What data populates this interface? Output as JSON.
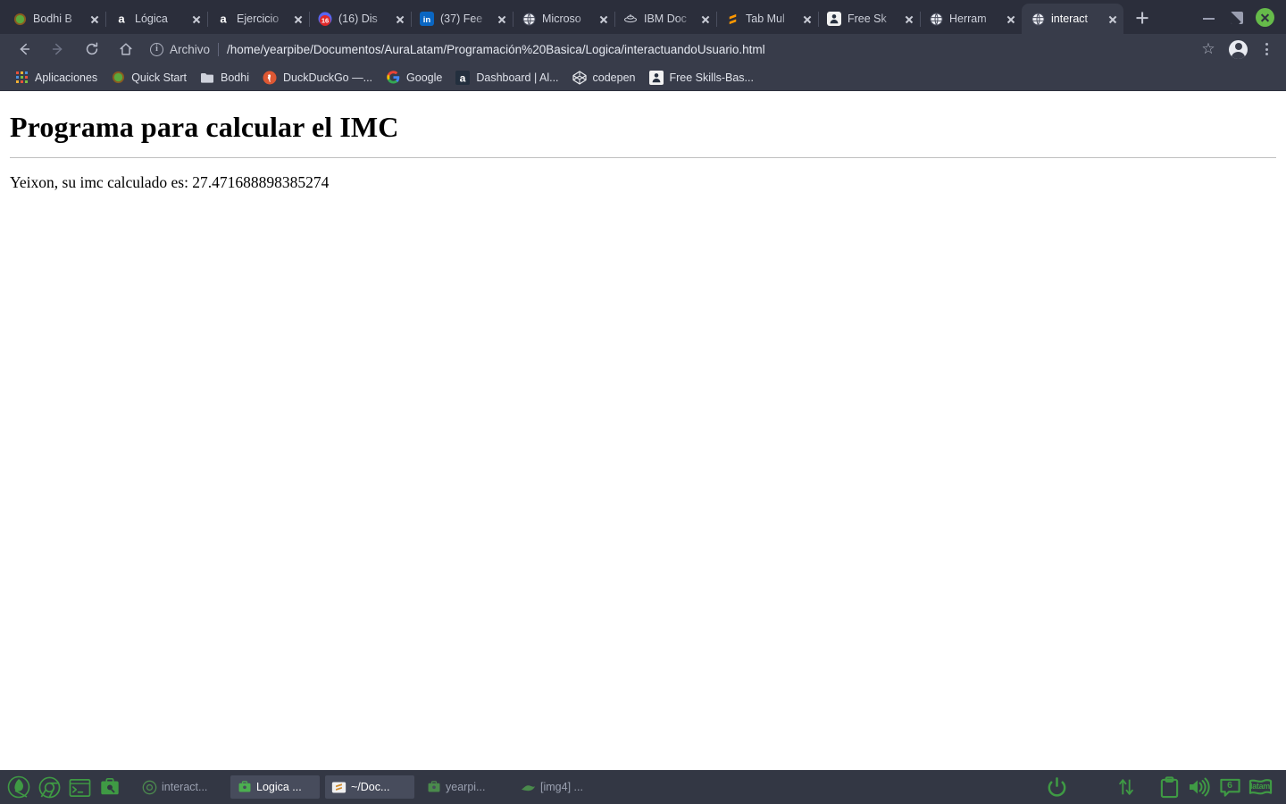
{
  "window": {
    "controls": {
      "minimize": "minimize",
      "maximize": "maximize",
      "close": "close"
    }
  },
  "tabs": [
    {
      "title": "Bodhi B",
      "favicon": "bodhi-leaf",
      "active": false
    },
    {
      "title": "Lógica ",
      "favicon": "amazon-a",
      "active": false
    },
    {
      "title": "Ejercicio",
      "favicon": "amazon-a",
      "active": false
    },
    {
      "title": "(16) Dis",
      "favicon": "discord-badge",
      "badge": "16",
      "active": false
    },
    {
      "title": "(37) Fee",
      "favicon": "linkedin-in",
      "active": false
    },
    {
      "title": "Microso",
      "favicon": "globe",
      "active": false
    },
    {
      "title": "IBM Doc",
      "favicon": "ibm-cloud",
      "active": false
    },
    {
      "title": "Tab Mul",
      "favicon": "sublime-s",
      "active": false
    },
    {
      "title": "Free Sk",
      "favicon": "freeskills",
      "active": false
    },
    {
      "title": "Herram",
      "favicon": "globe",
      "active": false
    },
    {
      "title": "interact",
      "favicon": "globe",
      "active": true
    }
  ],
  "newtab_label": "+",
  "toolbar": {
    "back": "Atrás",
    "forward": "Adelante",
    "reload": "Recargar",
    "home": "Inicio",
    "security_label": "Archivo",
    "url": "/home/yearpibe/Documentos/AuraLatam/Programación%20Basica/Logica/interactuandoUsuario.html",
    "bookmark_star": "☆",
    "profile": "profile",
    "menu": "menu"
  },
  "bookmarks": [
    {
      "label": "Aplicaciones",
      "icon": "apps-grid"
    },
    {
      "label": "Quick Start",
      "icon": "bodhi-leaf"
    },
    {
      "label": "Bodhi",
      "icon": "folder"
    },
    {
      "label": "DuckDuckGo —...",
      "icon": "duckduckgo"
    },
    {
      "label": "Google",
      "icon": "google-g"
    },
    {
      "label": "Dashboard | Al...",
      "icon": "amazon-a"
    },
    {
      "label": "codepen",
      "icon": "codepen"
    },
    {
      "label": "Free Skills-Bas...",
      "icon": "freeskills"
    }
  ],
  "page": {
    "heading": "Programa para calcular el IMC",
    "result_text": "Yeixon, su imc calculado es: 27.471688898385274"
  },
  "taskbar": {
    "launchers": [
      {
        "name": "bodhi-menu-icon"
      },
      {
        "name": "chrome-icon"
      },
      {
        "name": "terminal-icon"
      },
      {
        "name": "files-icon"
      }
    ],
    "tasks": [
      {
        "label": "interact...",
        "icon": "chrome-icon",
        "state": "dim"
      },
      {
        "label": "Logica ...",
        "icon": "files-icon",
        "state": "raised"
      },
      {
        "label": "~/Doc...",
        "icon": "sublime-icon",
        "state": "raised"
      },
      {
        "label": "yearpi...",
        "icon": "files-icon",
        "state": "dim"
      },
      {
        "label": "[img4] ...",
        "icon": "image-icon",
        "state": "dim"
      }
    ],
    "tray": [
      {
        "name": "power-icon"
      },
      {
        "name": "network-icon"
      },
      {
        "name": "clipboard-icon"
      },
      {
        "name": "volume-icon"
      },
      {
        "name": "messages-icon",
        "badge": "6"
      },
      {
        "name": "keyboard-layout-icon",
        "text": "latam"
      }
    ]
  },
  "colors": {
    "tabstrip_bg": "#2b2e3b",
    "toolbar_bg": "#383c4a",
    "taskbar_bg": "#333744",
    "accent_green": "#4a9e3f",
    "page_bg": "#ffffff"
  }
}
